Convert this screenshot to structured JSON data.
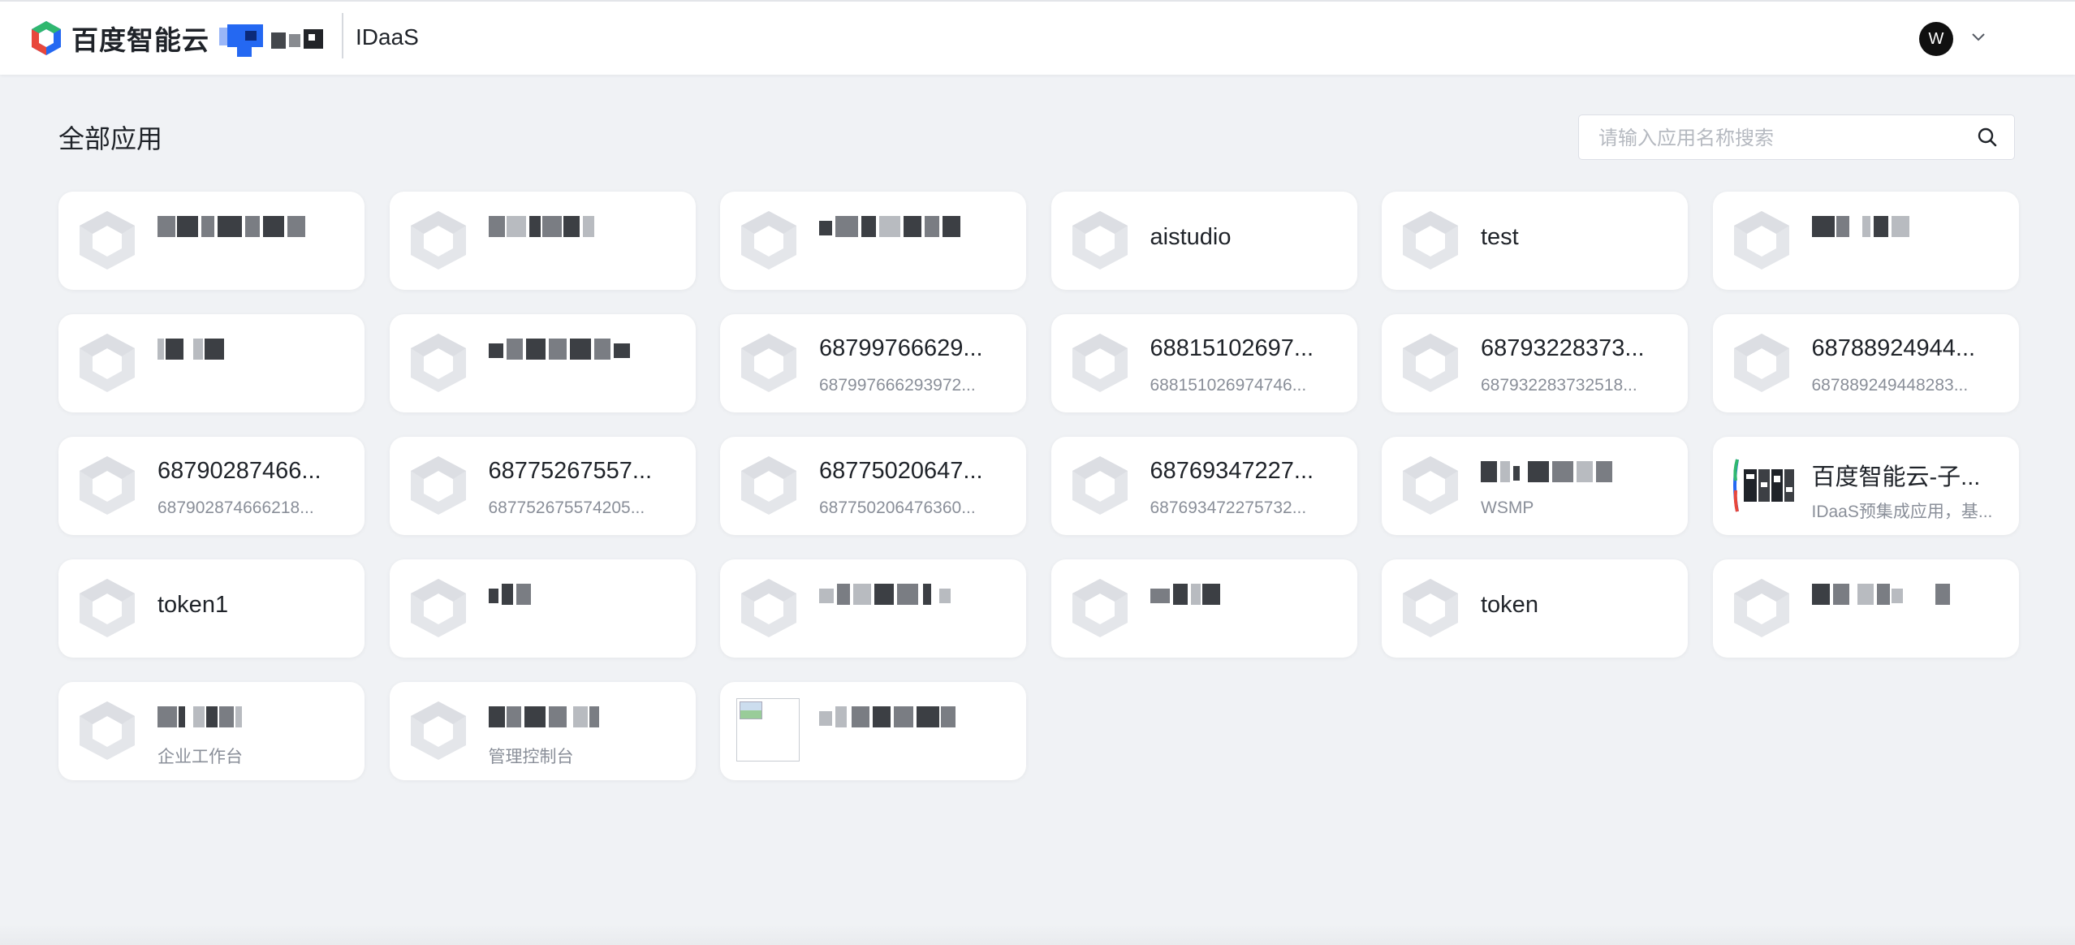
{
  "header": {
    "brand_name": "百度智能云",
    "product_name": "IDaaS",
    "user_initial": "W"
  },
  "page": {
    "title": "全部应用",
    "search_placeholder": "请输入应用名称搜索"
  },
  "colors": {
    "page_bg": "#f0f2f5",
    "card_bg": "#ffffff",
    "placeholder_icon": "#e4e6ea",
    "brand_blue": "#2468f2",
    "brand_red": "#e8473b",
    "brand_green": "#30b86f"
  },
  "apps": [
    {
      "title": "",
      "subtitle": "",
      "icon": "app-placeholder-icon",
      "redacted": true
    },
    {
      "title": "",
      "subtitle": "",
      "icon": "app-placeholder-icon",
      "redacted": true
    },
    {
      "title": "",
      "subtitle": "",
      "icon": "app-placeholder-icon",
      "redacted": true
    },
    {
      "title": "aistudio",
      "subtitle": "",
      "icon": "app-placeholder-icon"
    },
    {
      "title": "test",
      "subtitle": "",
      "icon": "app-placeholder-icon"
    },
    {
      "title": "",
      "subtitle": "",
      "icon": "app-placeholder-icon",
      "redacted": true
    },
    {
      "title": "",
      "subtitle": "",
      "icon": "app-placeholder-icon",
      "redacted": true
    },
    {
      "title": "",
      "subtitle": "",
      "icon": "app-placeholder-icon",
      "redacted": true
    },
    {
      "title": "68799766629...",
      "subtitle": "687997666293972...",
      "icon": "app-placeholder-icon"
    },
    {
      "title": "68815102697...",
      "subtitle": "688151026974746...",
      "icon": "app-placeholder-icon"
    },
    {
      "title": "68793228373...",
      "subtitle": "687932283732518...",
      "icon": "app-placeholder-icon"
    },
    {
      "title": "68788924944...",
      "subtitle": "687889249448283...",
      "icon": "app-placeholder-icon"
    },
    {
      "title": "68790287466...",
      "subtitle": "687902874666218...",
      "icon": "app-placeholder-icon"
    },
    {
      "title": "68775267557...",
      "subtitle": "687752675574205...",
      "icon": "app-placeholder-icon"
    },
    {
      "title": "68775020647...",
      "subtitle": "687750206476360...",
      "icon": "app-placeholder-icon"
    },
    {
      "title": "68769347227...",
      "subtitle": "687693472275732...",
      "icon": "app-placeholder-icon"
    },
    {
      "title": "",
      "subtitle": "WSMP",
      "icon": "app-placeholder-icon",
      "redacted": true
    },
    {
      "title": "百度智能云-子...",
      "subtitle": "IDaaS预集成应用，基...",
      "icon": "baidu-cloud-logo-icon"
    },
    {
      "title": "token1",
      "subtitle": "",
      "icon": "app-placeholder-icon"
    },
    {
      "title": "",
      "subtitle": "",
      "icon": "app-placeholder-icon",
      "redacted": true
    },
    {
      "title": "",
      "subtitle": "",
      "icon": "app-placeholder-icon",
      "redacted": true
    },
    {
      "title": "",
      "subtitle": "",
      "icon": "app-placeholder-icon",
      "redacted": true
    },
    {
      "title": "token",
      "subtitle": "",
      "icon": "app-placeholder-icon"
    },
    {
      "title": "",
      "subtitle": "",
      "icon": "app-placeholder-icon",
      "redacted": true
    },
    {
      "title": "",
      "subtitle": "企业工作台",
      "icon": "app-placeholder-icon",
      "redacted": true
    },
    {
      "title": "",
      "subtitle": "管理控制台",
      "icon": "app-placeholder-icon",
      "redacted": true
    },
    {
      "title": "",
      "subtitle": "",
      "icon": "broken-image-icon",
      "redacted": true
    }
  ]
}
